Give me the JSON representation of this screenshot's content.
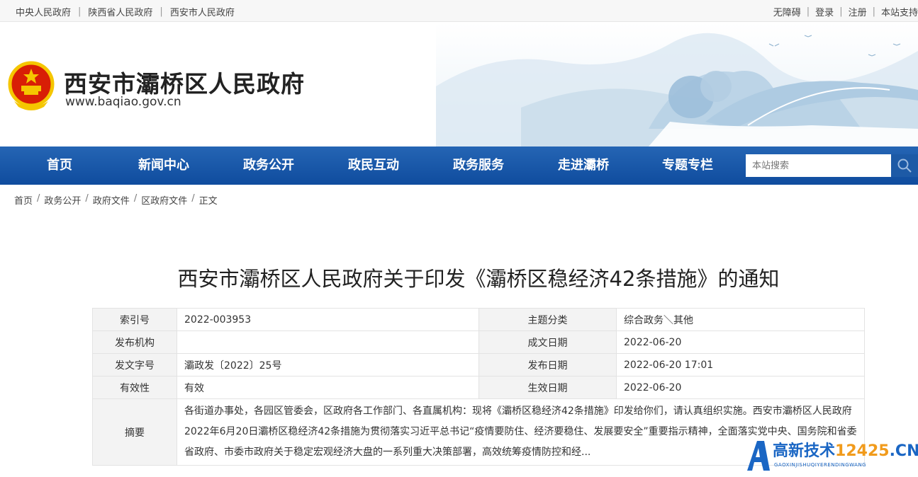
{
  "topbar": {
    "left_links": [
      "中央人民政府",
      "陕西省人民政府",
      "西安市人民政府"
    ],
    "right_links": [
      "无障碍",
      "登录",
      "注册",
      "本站支持"
    ]
  },
  "header": {
    "title": "西安市灞桥区人民政府",
    "url": "www.baqiao.gov.cn"
  },
  "nav": {
    "items": [
      "首页",
      "新闻中心",
      "政务公开",
      "政民互动",
      "政务服务",
      "走进灞桥",
      "专题专栏"
    ],
    "search_placeholder": "本站搜索"
  },
  "breadcrumb": [
    "首页",
    "政务公开",
    "政府文件",
    "区政府文件",
    "正文"
  ],
  "article": {
    "title": "西安市灞桥区人民政府关于印发《灞桥区稳经济42条措施》的通知"
  },
  "info": {
    "index_label": "索引号",
    "index_value": "2022-003953",
    "topic_label": "主题分类",
    "topic_value": "综合政务＼其他",
    "org_label": "发布机构",
    "org_value": "",
    "made_label": "成文日期",
    "made_value": "2022-06-20",
    "docno_label": "发文字号",
    "docno_value": "灞政发〔2022〕25号",
    "pub_label": "发布日期",
    "pub_value": "2022-06-20 17:01",
    "valid_label": "有效性",
    "valid_value": "有效",
    "eff_label": "生效日期",
    "eff_value": "2022-06-20",
    "summary_label": "摘要",
    "summary_value": "各街道办事处，各园区管委会，区政府各工作部门、各直属机构：现将《灞桥区稳经济42条措施》印发给你们，请认真组织实施。西安市灞桥区人民政府2022年6月20日灞桥区稳经济42条措施为贯彻落实习近平总书记“疫情要防住、经济要稳住、发展要安全”重要指示精神，全面落实党中央、国务院和省委省政府、市委市政府关于稳定宏观经济大盘的一系列重大决策部署，高效统筹疫情防控和经..."
  },
  "watermark": {
    "text_main": "高新技术",
    "text_num": "12425",
    "text_cn": ".CN",
    "text_sub": "GAOXINJISHUQIYERENDINGWANG"
  },
  "colors": {
    "nav_blue": "#1451a3",
    "search_btn": "#1d5aa6"
  }
}
